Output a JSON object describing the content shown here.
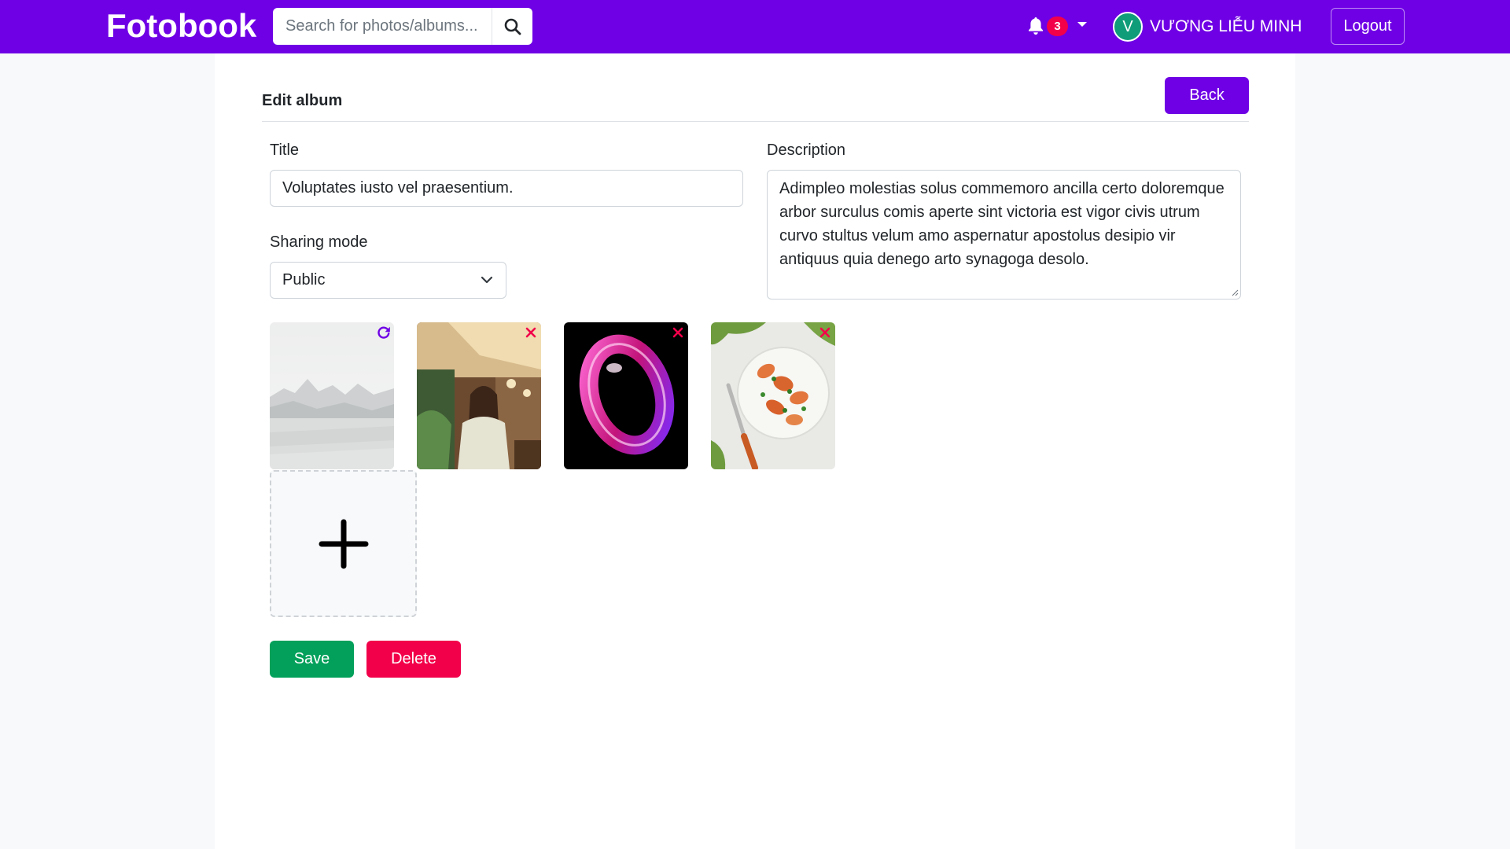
{
  "navbar": {
    "brand": "Fotobook",
    "search_placeholder": "Search for photos/albums...",
    "notification_count": "3",
    "user_initial": "V",
    "user_name": "VƯƠNG LIỄU MINH",
    "logout_label": "Logout",
    "color": "#6f00e5"
  },
  "page": {
    "title": "Edit album",
    "back_label": "Back"
  },
  "form": {
    "title_label": "Title",
    "title_value": "Voluptates iusto vel praesentium.",
    "sharing_label": "Sharing mode",
    "sharing_value": "Public",
    "description_label": "Description",
    "description_value": "Adimpleo molestias solus commemoro ancilla certo doloremque arbor surculus comis aperte sint victoria est vigor civis utrum curvo stultus velum amo aspernatur apostolus desipio vir antiquus quia denego arto synagoga desolo."
  },
  "photos": [
    {
      "subject": "misty mountain lake",
      "action": "restore-icon",
      "removed": true
    },
    {
      "subject": "woman in cafe",
      "action": "remove-icon",
      "removed": false
    },
    {
      "subject": "pink abstract ring",
      "action": "remove-icon",
      "removed": false
    },
    {
      "subject": "plate of food",
      "action": "remove-icon",
      "removed": false
    }
  ],
  "actions": {
    "save_label": "Save",
    "delete_label": "Delete",
    "save_color": "#02a05a",
    "delete_color": "#f2004a"
  }
}
